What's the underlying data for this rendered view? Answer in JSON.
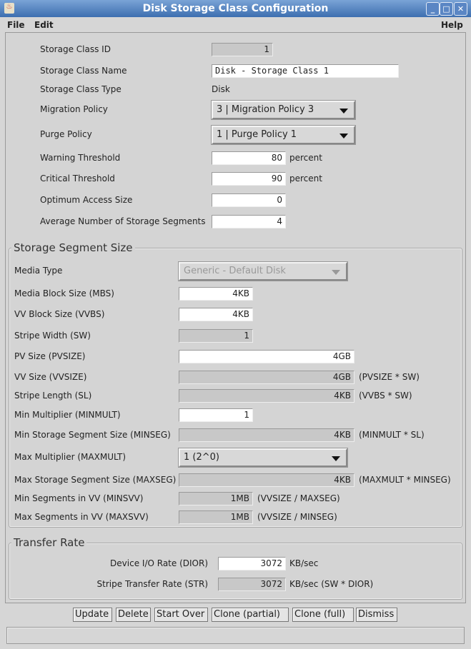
{
  "window": {
    "title": "Disk Storage Class Configuration"
  },
  "menu": {
    "file": "File",
    "edit": "Edit",
    "help": "Help"
  },
  "general": [
    {
      "label": "Storage Class ID",
      "value": "1",
      "kind": "ro"
    },
    {
      "label": "Storage Class Name",
      "value": "Disk - Storage Class 1",
      "kind": "name"
    },
    {
      "label": "Storage Class Type",
      "value": "Disk",
      "kind": "text"
    },
    {
      "label": "Migration Policy",
      "value": "3 | Migration Policy 3",
      "kind": "combo"
    },
    {
      "label": "Purge Policy",
      "value": "1 | Purge Policy 1",
      "kind": "combo"
    },
    {
      "label": "Warning Threshold",
      "value": "80",
      "kind": "edit",
      "unit": "percent"
    },
    {
      "label": "Critical Threshold",
      "value": "90",
      "kind": "edit",
      "unit": "percent"
    },
    {
      "label": "Optimum Access Size",
      "value": "0",
      "kind": "edit"
    },
    {
      "label": "Average Number of Storage Segments",
      "value": "4",
      "kind": "edit"
    }
  ],
  "segment": {
    "title": "Storage Segment Size",
    "rows": [
      {
        "label": "Media Type",
        "value": "Generic - Default Disk",
        "kind": "combo-dis"
      },
      {
        "label": "Media Block Size (MBS)",
        "value": "4KB",
        "kind": "short"
      },
      {
        "label": "VV Block Size (VVBS)",
        "value": "4KB",
        "kind": "short"
      },
      {
        "label": "Stripe Width (SW)",
        "value": "1",
        "kind": "short-ro"
      },
      {
        "label": "PV Size (PVSIZE)",
        "value": "4GB",
        "kind": "long"
      },
      {
        "label": "VV Size (VVSIZE)",
        "value": "4GB",
        "kind": "long-ro",
        "note": "(PVSIZE * SW)"
      },
      {
        "label": "Stripe Length (SL)",
        "value": "4KB",
        "kind": "long-ro",
        "note": "(VVBS * SW)"
      },
      {
        "label": "Min Multiplier (MINMULT)",
        "value": "1",
        "kind": "short"
      },
      {
        "label": "Min Storage Segment Size (MINSEG)",
        "value": "4KB",
        "kind": "long-ro",
        "note": "(MINMULT * SL)"
      },
      {
        "label": "Max Multiplier (MAXMULT)",
        "value": "1 (2^0)",
        "kind": "combo"
      },
      {
        "label": "Max Storage Segment Size (MAXSEG)",
        "value": "4KB",
        "kind": "long-ro",
        "note": "(MAXMULT * MINSEG)"
      },
      {
        "label": "Min Segments in VV (MINSVV)",
        "value": "1MB",
        "kind": "short-ro",
        "note": "(VVSIZE / MAXSEG)"
      },
      {
        "label": "Max Segments in VV (MAXSVV)",
        "value": "1MB",
        "kind": "short-ro",
        "note": "(VVSIZE / MINSEG)"
      }
    ]
  },
  "transfer": {
    "title": "Transfer Rate",
    "rows": [
      {
        "label": "Device I/O Rate (DIOR)",
        "value": "3072",
        "kind": "edit",
        "unit": "KB/sec"
      },
      {
        "label": "Stripe Transfer Rate (STR)",
        "value": "3072",
        "kind": "ro",
        "unit": "KB/sec (SW * DIOR)"
      }
    ]
  },
  "buttons": [
    "Update",
    "Delete",
    "Start Over",
    "Clone (partial)",
    "Clone (full)",
    "Dismiss"
  ]
}
